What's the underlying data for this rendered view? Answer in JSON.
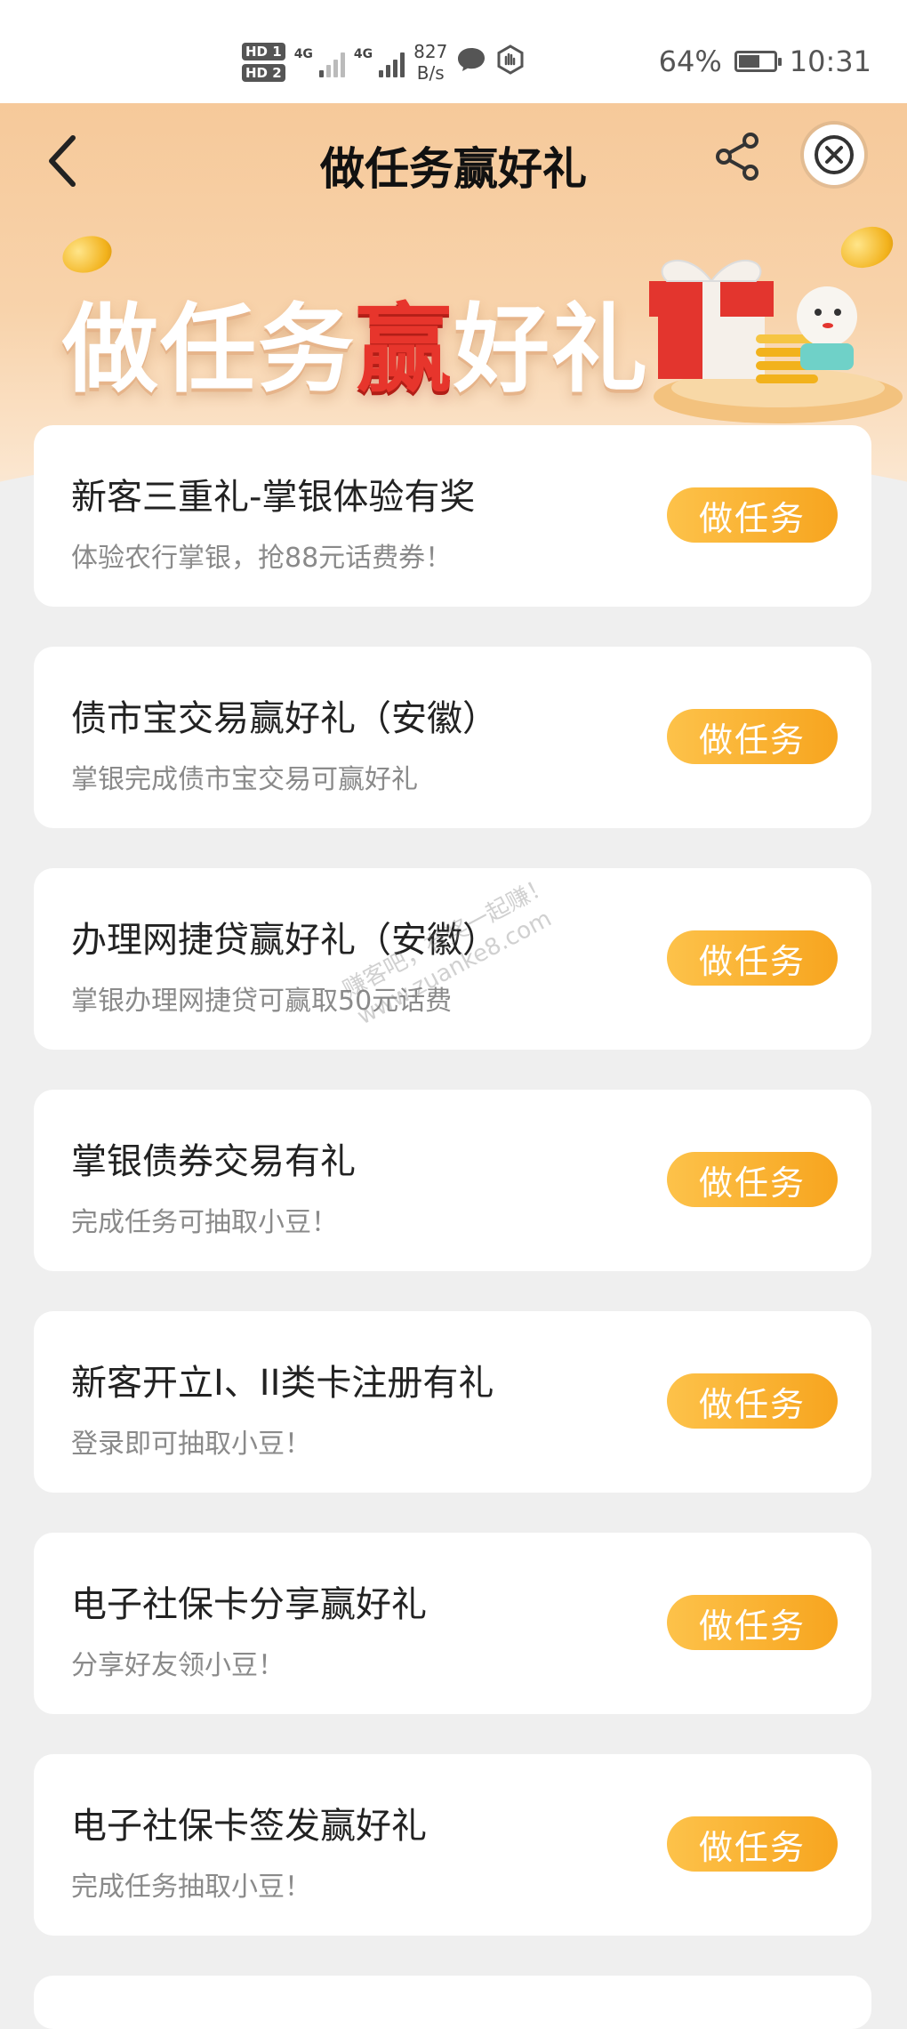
{
  "status_bar": {
    "hd1": "HD",
    "hd1_sub": "1",
    "hd2": "HD",
    "hd2_sub": "2",
    "signal1_label": "4G",
    "signal2_label": "4G",
    "net_speed_value": "827",
    "net_speed_unit": "B/s",
    "battery_percent": "64%",
    "battery_level": 0.64,
    "time": "10:31"
  },
  "header": {
    "title": "做任务赢好礼",
    "back_icon": "chevron-left-icon",
    "share_icon": "share-icon",
    "close_icon": "close-circle-icon"
  },
  "banner": {
    "title_part1": "做任务",
    "title_highlight": "赢",
    "title_part2": "好礼",
    "highlight_color": "#e7352c"
  },
  "tasks": [
    {
      "title": "新客三重礼-掌银体验有奖",
      "subtitle": "体验农行掌银，抢88元话费券！",
      "button": "做任务"
    },
    {
      "title": "债市宝交易赢好礼（安徽）",
      "subtitle": "掌银完成债市宝交易可赢好礼",
      "button": "做任务"
    },
    {
      "title": "办理网捷贷赢好礼（安徽）",
      "subtitle": "掌银办理网捷贷可赢取50元话费",
      "button": "做任务"
    },
    {
      "title": "掌银债券交易有礼",
      "subtitle": "完成任务可抽取小豆！",
      "button": "做任务"
    },
    {
      "title": "新客开立I、II类卡注册有礼",
      "subtitle": "登录即可抽取小豆！",
      "button": "做任务"
    },
    {
      "title": "电子社保卡分享赢好礼",
      "subtitle": "分享好友领小豆！",
      "button": "做任务"
    },
    {
      "title": "电子社保卡签发赢好礼",
      "subtitle": "完成任务抽取小豆！",
      "button": "做任务"
    }
  ],
  "watermark": {
    "line1": "赚客吧，有奖一起赚！",
    "line2": "www.zuanke8.com"
  },
  "colors": {
    "accent": "#f7a51f",
    "header_bg": "#f6c99a",
    "page_bg": "#efefef"
  }
}
